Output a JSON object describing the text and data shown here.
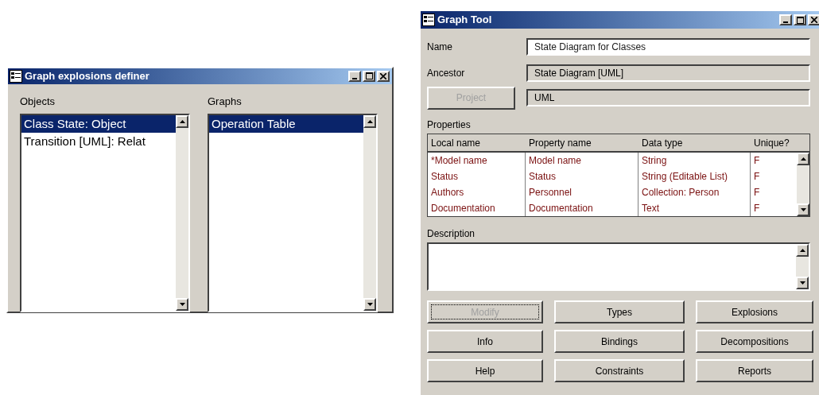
{
  "explosions_window": {
    "title": "Graph explosions definer",
    "objects": {
      "label": "Objects",
      "items": [
        {
          "text": "Class State: Object",
          "selected": true
        },
        {
          "text": "Transition [UML]: Relat",
          "selected": false
        }
      ]
    },
    "graphs": {
      "label": "Graphs",
      "items": [
        {
          "text": "Operation Table",
          "selected": true
        }
      ]
    }
  },
  "graph_tool": {
    "title": "Graph Tool",
    "name": {
      "label": "Name",
      "value": "State Diagram for Classes"
    },
    "ancestor": {
      "label": "Ancestor",
      "value": "State Diagram [UML]"
    },
    "project": {
      "button": {
        "label": "Project",
        "disabled": true
      },
      "value": "UML"
    },
    "properties": {
      "label": "Properties",
      "columns": [
        "Local name",
        "Property name",
        "Data type",
        "Unique?"
      ],
      "rows": [
        [
          "*Model name",
          "Model name",
          "String",
          "F"
        ],
        [
          "Status",
          "Status",
          "String (Editable List)",
          "F"
        ],
        [
          "Authors",
          "Personnel",
          "Collection: Person",
          "F"
        ],
        [
          "Documentation",
          "Documentation",
          "Text",
          "F"
        ]
      ]
    },
    "description": {
      "label": "Description"
    },
    "buttons": [
      {
        "label": "Modify",
        "disabled": true,
        "focused": true
      },
      {
        "label": "Types",
        "disabled": false,
        "focused": false
      },
      {
        "label": "Explosions",
        "disabled": false,
        "focused": false
      },
      {
        "label": "Info",
        "disabled": false,
        "focused": false
      },
      {
        "label": "Bindings",
        "disabled": false,
        "focused": false
      },
      {
        "label": "Decompositions",
        "disabled": false,
        "focused": false
      },
      {
        "label": "Help",
        "disabled": false,
        "focused": false
      },
      {
        "label": "Constraints",
        "disabled": false,
        "focused": false
      },
      {
        "label": "Reports",
        "disabled": false,
        "focused": false
      }
    ]
  }
}
